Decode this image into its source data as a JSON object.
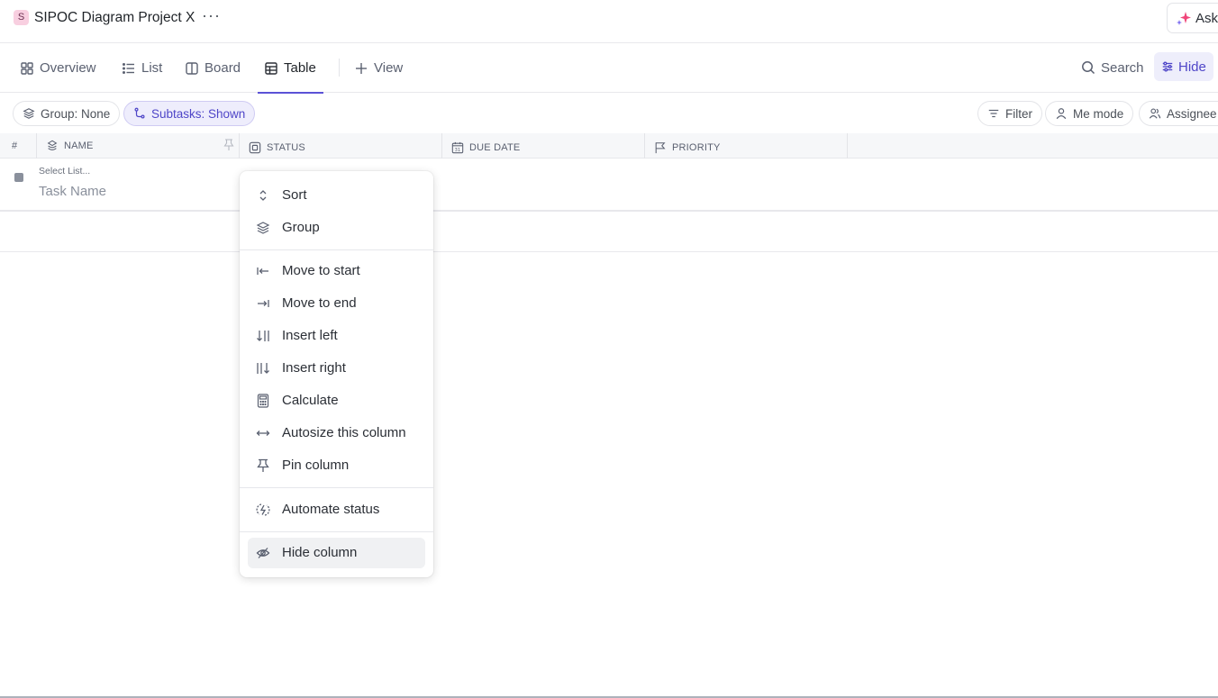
{
  "header": {
    "project_badge": "S",
    "project_title": "SIPOC Diagram Project X",
    "more_label": "···",
    "ask_label": "Ask",
    "colors": {
      "badge_bg": "#f8cfe0",
      "accent": "#5b52d6"
    }
  },
  "views": {
    "tabs": [
      {
        "label": "Overview",
        "icon": "overview-grid-icon",
        "active": false
      },
      {
        "label": "List",
        "icon": "list-icon",
        "active": false
      },
      {
        "label": "Board",
        "icon": "board-icon",
        "active": false
      },
      {
        "label": "Table",
        "icon": "table-icon",
        "active": true
      }
    ],
    "add_view_label": "View",
    "search_label": "Search",
    "hide_label": "Hide"
  },
  "filters": {
    "group_label": "Group: None",
    "subtasks_label": "Subtasks: Shown",
    "filter_label": "Filter",
    "me_mode_label": "Me mode",
    "assignee_label": "Assignee"
  },
  "table": {
    "columns": [
      {
        "label": "#",
        "icon": null
      },
      {
        "label": "NAME",
        "icon": "name-stack-icon"
      },
      {
        "label": "STATUS",
        "icon": "status-square-icon"
      },
      {
        "label": "DUE DATE",
        "icon": "calendar-icon",
        "icon_text": "31"
      },
      {
        "label": "PRIORITY",
        "icon": "flag-icon"
      }
    ],
    "new_row": {
      "select_list_label": "Select List...",
      "task_name_placeholder": "Task Name"
    }
  },
  "context_menu": {
    "groups": [
      [
        {
          "label": "Sort",
          "icon": "sort-icon"
        },
        {
          "label": "Group",
          "icon": "layers-icon"
        }
      ],
      [
        {
          "label": "Move to start",
          "icon": "move-to-start-icon"
        },
        {
          "label": "Move to end",
          "icon": "move-to-end-icon"
        },
        {
          "label": "Insert left",
          "icon": "insert-left-icon"
        },
        {
          "label": "Insert right",
          "icon": "insert-right-icon"
        },
        {
          "label": "Calculate",
          "icon": "calculator-icon"
        },
        {
          "label": "Autosize this column",
          "icon": "autosize-icon"
        },
        {
          "label": "Pin column",
          "icon": "pin-icon"
        }
      ],
      [
        {
          "label": "Automate status",
          "icon": "automate-icon"
        }
      ],
      [
        {
          "label": "Hide column",
          "icon": "eye-off-icon",
          "highlighted": true
        }
      ]
    ]
  }
}
